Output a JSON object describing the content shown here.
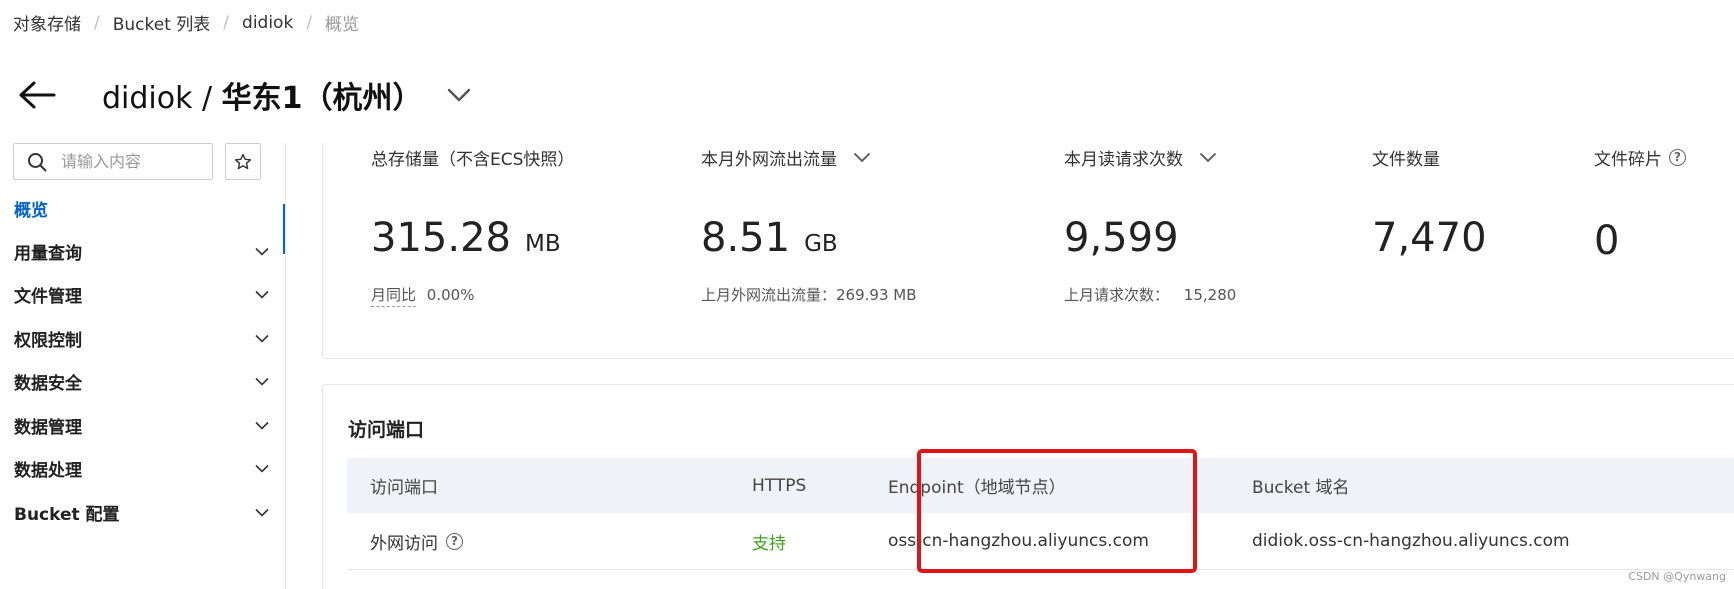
{
  "breadcrumb": [
    "对象存储",
    "Bucket 列表",
    "didiok",
    "概览"
  ],
  "header": {
    "bucket": "didiok",
    "separator": " / ",
    "region": "华东1（杭州）"
  },
  "sidebar": {
    "search_placeholder": "请输入内容",
    "items": [
      {
        "label": "概览",
        "active": true
      },
      {
        "label": "用量查询"
      },
      {
        "label": "文件管理"
      },
      {
        "label": "权限控制"
      },
      {
        "label": "数据安全"
      },
      {
        "label": "数据管理"
      },
      {
        "label": "数据处理"
      },
      {
        "label": "Bucket 配置"
      }
    ]
  },
  "stats": {
    "storage": {
      "label": "总存储量（不含ECS快照）",
      "value": "315.28",
      "unit": "MB",
      "sub_label": "月同比",
      "sub_value": "0.00%"
    },
    "traffic": {
      "label": "本月外网流出流量",
      "value": "8.51",
      "unit": "GB",
      "sub": "上月外网流出流量：269.93 MB"
    },
    "requests": {
      "label": "本月读请求次数",
      "value": "9,599",
      "sub_label": "上月请求次数：",
      "sub_value": "15,280"
    },
    "files": {
      "label": "文件数量",
      "value": "7,470"
    },
    "fragments": {
      "label": "文件碎片",
      "value": "0"
    }
  },
  "endpoint": {
    "title": "访问端口",
    "columns": [
      "访问端口",
      "HTTPS",
      "Endpoint（地域节点）",
      "Bucket 域名"
    ],
    "rows": [
      {
        "access": "外网访问",
        "https": "支持",
        "endpoint": "oss-cn-hangzhou.aliyuncs.com",
        "domain": "didiok.oss-cn-hangzhou.aliyuncs.com"
      }
    ]
  },
  "watermark": "CSDN @Qynwang",
  "colors": {
    "accent": "#0064c8",
    "success": "#3ba318",
    "highlight": "#e01414"
  }
}
